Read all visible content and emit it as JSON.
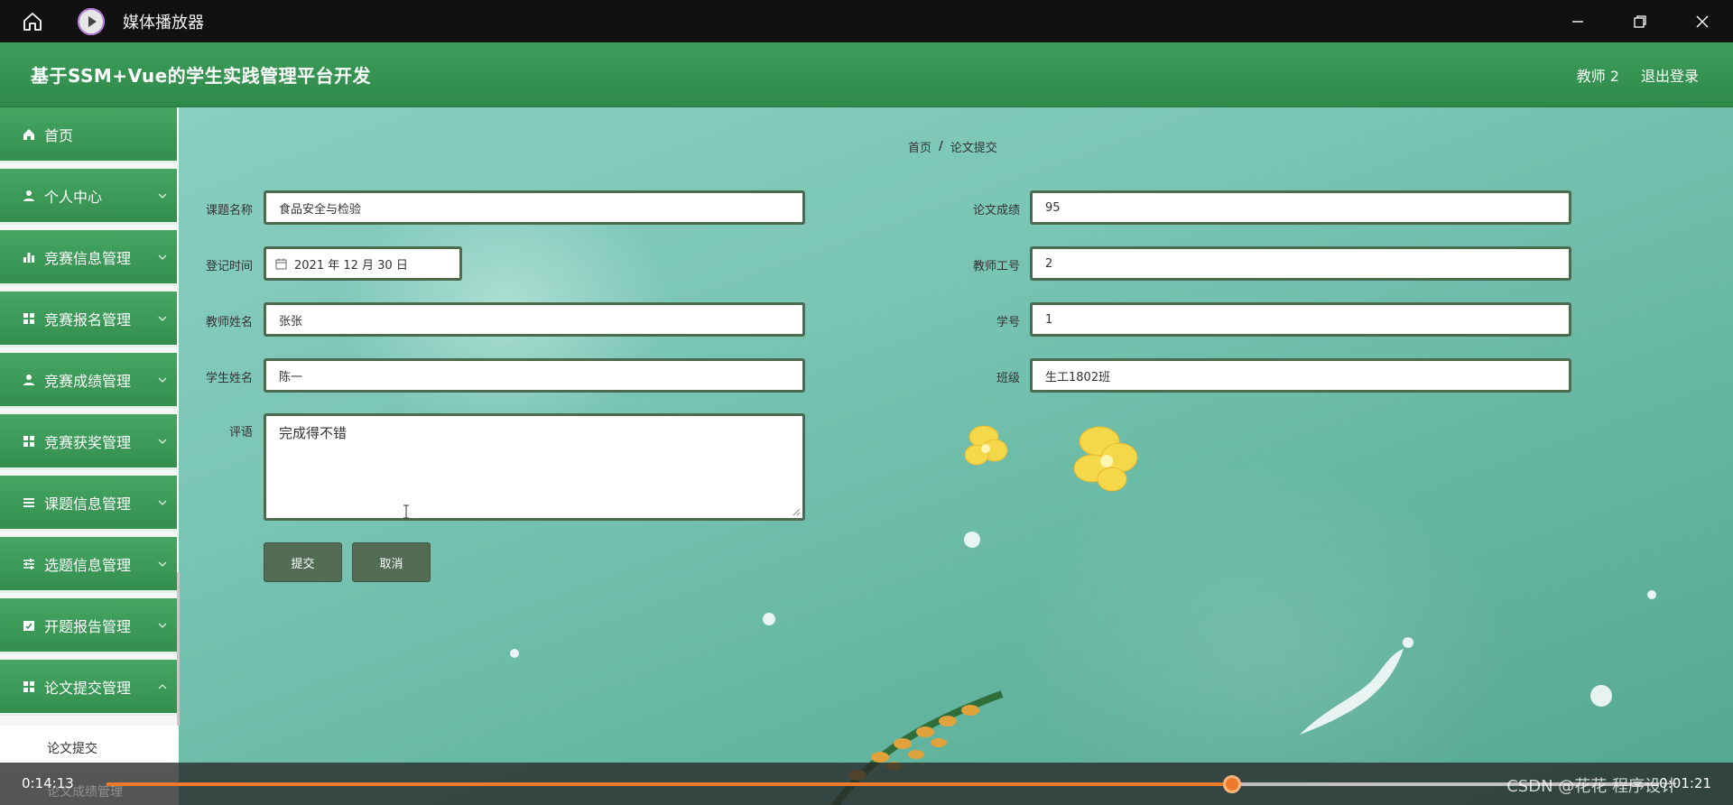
{
  "player": {
    "title": "媒体播放器",
    "current_time": "0:14:13",
    "total_time": "0:01:21",
    "progress": 0.725,
    "watermark": "CSDN @花花 程序设计",
    "accent": "#f07a2c"
  },
  "app": {
    "title": "基于SSM+Vue的学生实践管理平台开发",
    "user": "教师 2",
    "logout": "退出登录",
    "brand_color": "#348f4f"
  },
  "sidebar": {
    "items": [
      {
        "label": "首页",
        "icon": "home-icon"
      },
      {
        "label": "个人中心",
        "icon": "user-icon"
      },
      {
        "label": "竞赛信息管理",
        "icon": "bar-chart-icon"
      },
      {
        "label": "竞赛报名管理",
        "icon": "grid-icon"
      },
      {
        "label": "竞赛成绩管理",
        "icon": "user-icon"
      },
      {
        "label": "竞赛获奖管理",
        "icon": "grid-icon"
      },
      {
        "label": "课题信息管理",
        "icon": "list-icon"
      },
      {
        "label": "选题信息管理",
        "icon": "sliders-icon"
      },
      {
        "label": "开题报告管理",
        "icon": "calendar-check-icon"
      },
      {
        "label": "论文提交管理",
        "icon": "grid-icon"
      }
    ],
    "submenu": {
      "label": "论文提交"
    },
    "partially_hidden": "论文成绩管理"
  },
  "breadcrumb": {
    "home": "首页",
    "separator": "/",
    "current": "论文提交"
  },
  "form": {
    "topic_name": {
      "label": "课题名称",
      "value": "食品安全与检验"
    },
    "paper_score": {
      "label": "论文成绩",
      "value": "95"
    },
    "register_time": {
      "label": "登记时间",
      "value": "2021 年 12 月 30 日"
    },
    "teacher_no": {
      "label": "教师工号",
      "value": "2"
    },
    "teacher_name": {
      "label": "教师姓名",
      "value": "张张"
    },
    "student_no": {
      "label": "学号",
      "value": "1"
    },
    "student_name": {
      "label": "学生姓名",
      "value": "陈一"
    },
    "class_name": {
      "label": "班级",
      "value": "生工1802班"
    },
    "comment": {
      "label": "评语",
      "value": "完成得不错"
    },
    "submit": "提交",
    "cancel": "取消"
  }
}
